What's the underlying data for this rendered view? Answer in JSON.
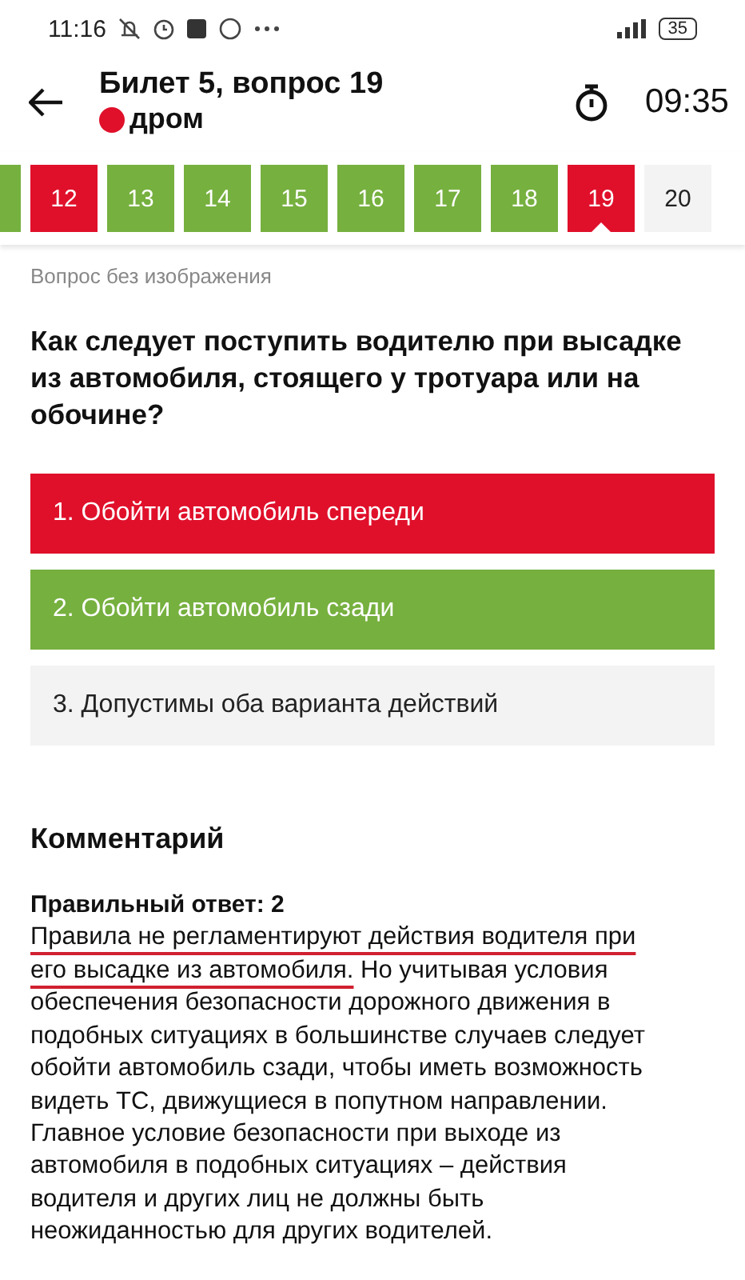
{
  "status_bar": {
    "time": "11:16",
    "battery": "35"
  },
  "header": {
    "title": "Билет 5, вопрос 19",
    "brand": "дром",
    "timer": "09:35"
  },
  "questions": [
    {
      "kind": "correct",
      "selected": false
    },
    {
      "number": "12",
      "kind": "wrong",
      "selected": false
    },
    {
      "number": "13",
      "kind": "correct",
      "selected": false
    },
    {
      "number": "14",
      "kind": "correct",
      "selected": false
    },
    {
      "number": "15",
      "kind": "correct",
      "selected": false
    },
    {
      "number": "16",
      "kind": "correct",
      "selected": false
    },
    {
      "number": "17",
      "kind": "correct",
      "selected": false
    },
    {
      "number": "18",
      "kind": "correct",
      "selected": false
    },
    {
      "number": "19",
      "kind": "wrong",
      "selected": true
    },
    {
      "number": "20",
      "kind": "unanswered",
      "selected": false
    }
  ],
  "image_note": "Вопрос без изображения",
  "question": "Как следует поступить водителю при высадке из автомобиля, стоящего у тротуара или на обочине?",
  "answers": [
    {
      "text": "1. Обойти автомобиль спереди",
      "kind": "wrong"
    },
    {
      "text": "2. Обойти автомобиль сзади",
      "kind": "correct"
    },
    {
      "text": "3. Допустимы оба варианта действий",
      "kind": "unanswered"
    }
  ],
  "comment": {
    "title": "Комментарий",
    "correct_answer": "Правильный ответ: 2",
    "body": [
      {
        "text": "Правила не регламентируют действия водителя при его высадке из автомобиля.",
        "underlined": true
      },
      {
        "text": " Но учитывая условия обеспечения безопасности дорожного движения в подобных ситуациях в большинстве случаев следует обойти автомобиль сзади, чтобы иметь возможность видеть ТС, движущиеся в попутном направлении. Главное условие безопасности при выходе из автомобиля в подобных ситуациях – действия водителя и других лиц не должны быть неожиданностью для других водителей.",
        "underlined": false
      }
    ]
  }
}
